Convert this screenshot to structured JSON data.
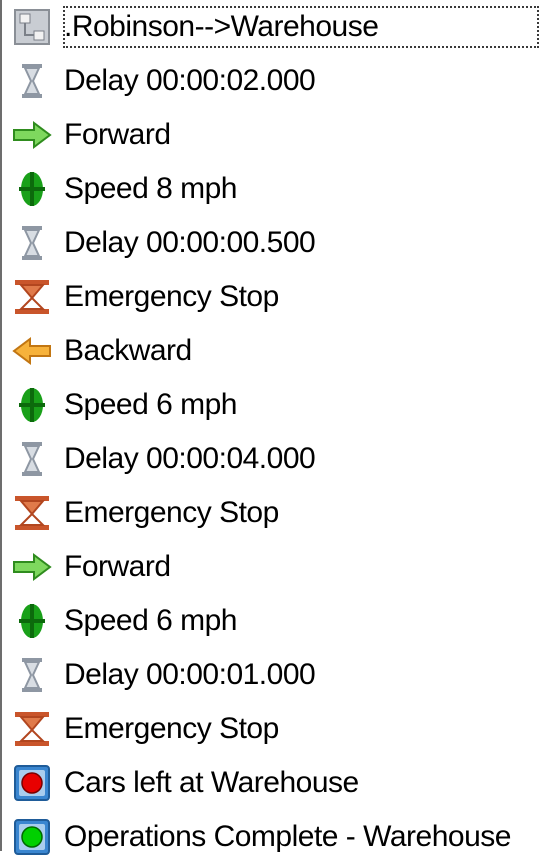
{
  "tree": {
    "items": [
      {
        "label": ".Robinson-->Warehouse",
        "icon": "route-icon",
        "selected": true
      },
      {
        "label": "Delay 00:00:02.000",
        "icon": "hourglass-icon"
      },
      {
        "label": "Forward",
        "icon": "forward-arrow-icon"
      },
      {
        "label": "Speed 8 mph",
        "icon": "speed-icon"
      },
      {
        "label": "Delay 00:00:00.500",
        "icon": "hourglass-icon"
      },
      {
        "label": "Emergency Stop",
        "icon": "emergency-stop-icon"
      },
      {
        "label": "Backward",
        "icon": "backward-arrow-icon"
      },
      {
        "label": "Speed 6 mph",
        "icon": "speed-icon"
      },
      {
        "label": "Delay 00:00:04.000",
        "icon": "hourglass-icon"
      },
      {
        "label": "Emergency Stop",
        "icon": "emergency-stop-icon"
      },
      {
        "label": "Forward",
        "icon": "forward-arrow-icon"
      },
      {
        "label": "Speed 6 mph",
        "icon": "speed-icon"
      },
      {
        "label": "Delay 00:00:01.000",
        "icon": "hourglass-icon"
      },
      {
        "label": "Emergency Stop",
        "icon": "emergency-stop-icon"
      },
      {
        "label": "Cars left at Warehouse",
        "icon": "red-status-icon"
      },
      {
        "label": "Operations Complete - Warehouse",
        "icon": "green-status-icon"
      }
    ]
  },
  "colors": {
    "forward": "#64c84a",
    "backward": "#f5a31c",
    "speed": "#1faa1f",
    "stop": "#c8502a",
    "hourglass": "#9aa4b2",
    "status_red": "#e80000",
    "status_green": "#00d000",
    "status_frame": "#2c6fb3"
  }
}
